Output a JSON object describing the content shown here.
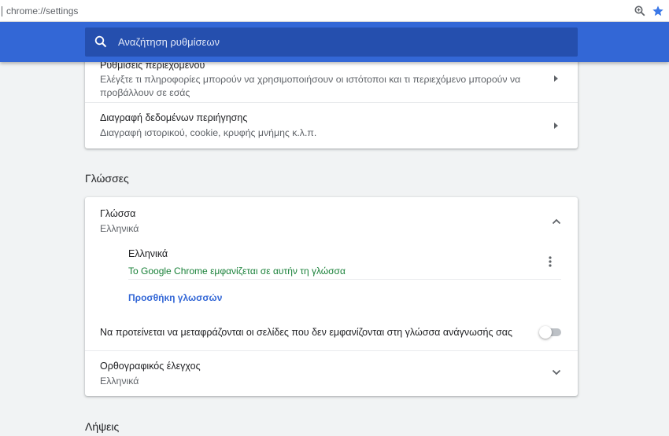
{
  "address_bar": {
    "url": "chrome://settings"
  },
  "search": {
    "placeholder": "Αναζήτηση ρυθμίσεων"
  },
  "privacy_card": {
    "content_settings": {
      "title": "Ρυθμίσεις περιεχομένου",
      "subtitle_line1": "Ελέγξτε τι πληροφορίες μπορούν να χρησιμοποιήσουν οι ιστότοποι και τι περιεχόμενο μπορούν να",
      "subtitle_line2": "προβάλλουν σε εσάς"
    },
    "clear_data": {
      "title": "Διαγραφή δεδομένων περιήγησης",
      "subtitle": "Διαγραφή ιστορικού, cookie, κρυφής μνήμης κ.λ.π."
    }
  },
  "languages_section": {
    "heading": "Γλώσσες",
    "language_row": {
      "title": "Γλώσσα",
      "value": "Ελληνικά"
    },
    "language_entry": {
      "name": "Ελληνικά",
      "note": "Το Google Chrome εμφανίζεται σε αυτήν τη γλώσσα"
    },
    "add_languages": "Προσθήκη γλωσσών",
    "translate_offer": {
      "label": "Να προτείνεται να μεταφράζονται οι σελίδες που δεν εμφανίζονται στη γλώσσα ανάγνωσής σας",
      "enabled": false
    },
    "spell_check": {
      "title": "Ορθογραφικός έλεγχος",
      "value": "Ελληνικά"
    }
  },
  "downloads_section": {
    "heading": "Λήψεις"
  },
  "colors": {
    "header_blue": "#3367d6",
    "search_bg": "#254fae",
    "note_green": "#188038",
    "link_blue": "#3367d6"
  }
}
